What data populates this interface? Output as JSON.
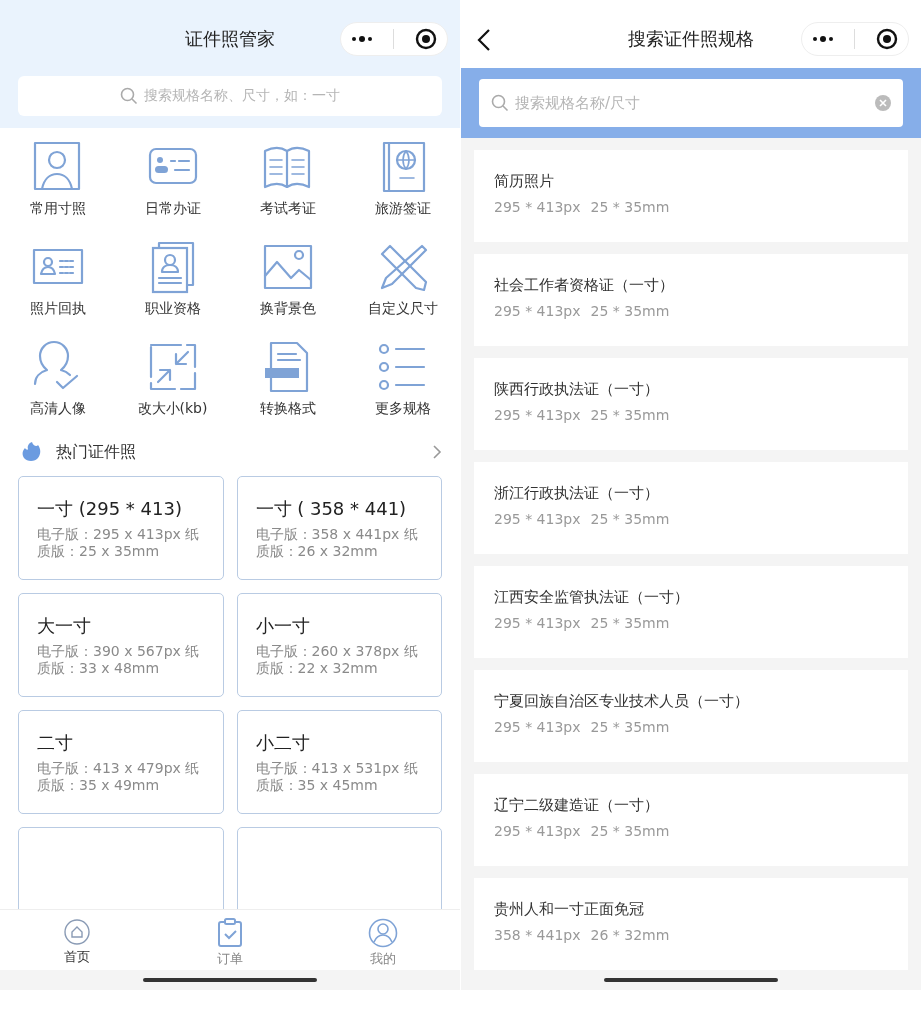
{
  "home": {
    "title": "证件照管家",
    "search": {
      "placeholder": "搜索规格名称、尺寸，如：一寸"
    },
    "shortcuts": [
      {
        "label": "常用寸照"
      },
      {
        "label": "日常办证"
      },
      {
        "label": "考试考证"
      },
      {
        "label": "旅游签证"
      },
      {
        "label": "照片回执"
      },
      {
        "label": "职业资格"
      },
      {
        "label": "换背景色"
      },
      {
        "label": "自定义尺寸"
      },
      {
        "label": "高清人像"
      },
      {
        "label": "改大小(kb)"
      },
      {
        "label": "转换格式"
      },
      {
        "label": "更多规格"
      }
    ],
    "hot_section": {
      "title": "热门证件照"
    },
    "hot_specs": [
      {
        "title": "一寸 (295 * 413)",
        "detail": "电子版：295 x 413px 纸质版：25 x 35mm"
      },
      {
        "title": "一寸 ( 358 * 441)",
        "detail": "电子版：358 x 441px 纸质版：26 x 32mm"
      },
      {
        "title": "大一寸",
        "detail": "电子版：390 x 567px 纸质版：33 x 48mm"
      },
      {
        "title": "小一寸",
        "detail": "电子版：260 x 378px 纸质版：22 x 32mm"
      },
      {
        "title": "二寸",
        "detail": "电子版：413 x 479px 纸质版：35 x 49mm"
      },
      {
        "title": "小二寸",
        "detail": "电子版：413 x 531px 纸质版：35 x 45mm"
      }
    ],
    "tab_bar": [
      {
        "label": "首页",
        "selected": true
      },
      {
        "label": "订单",
        "selected": false
      },
      {
        "label": "我的",
        "selected": false
      }
    ]
  },
  "search_page": {
    "title": "搜索证件照规格",
    "search": {
      "placeholder": "搜索规格名称/尺寸"
    },
    "results": [
      {
        "name": "简历照片",
        "pixels": "295 * 413px",
        "size": "25 * 35mm"
      },
      {
        "name": "社会工作者资格证（一寸）",
        "pixels": "295 * 413px",
        "size": "25 * 35mm"
      },
      {
        "name": "陕西行政执法证（一寸）",
        "pixels": "295 * 413px",
        "size": "25 * 35mm"
      },
      {
        "name": "浙江行政执法证（一寸）",
        "pixels": "295 * 413px",
        "size": "25 * 35mm"
      },
      {
        "name": "江西安全监管执法证（一寸）",
        "pixels": "295 * 413px",
        "size": "25 * 35mm"
      },
      {
        "name": "宁夏回族自治区专业技术人员（一寸）",
        "pixels": "295 * 413px",
        "size": "25 * 35mm"
      },
      {
        "name": "辽宁二级建造证（一寸）",
        "pixels": "295 * 413px",
        "size": "25 * 35mm"
      },
      {
        "name": "贵州人和一寸正面免冠",
        "pixels": "358 * 441px",
        "size": "26 * 32mm"
      }
    ]
  }
}
